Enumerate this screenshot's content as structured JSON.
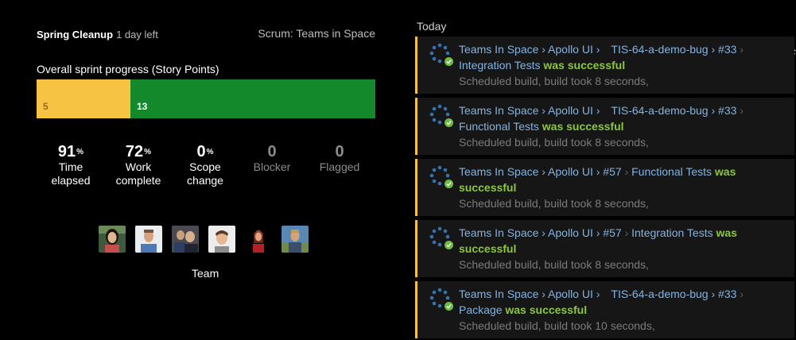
{
  "sprint": {
    "name": "Spring Cleanup",
    "days_left": "1 day left",
    "board": "Scrum: Teams in Space"
  },
  "progress": {
    "title": "Overall sprint progress (Story Points)",
    "todo_points": "5",
    "done_points": "13",
    "todo_color": "#f6c342",
    "done_color": "#14892c"
  },
  "stats": [
    {
      "value": "91",
      "unit": "%",
      "label_1": "Time",
      "label_2": "elapsed"
    },
    {
      "value": "72",
      "unit": "%",
      "label_1": "Work",
      "label_2": "complete"
    },
    {
      "value": "0",
      "unit": "%",
      "label_1": "Scope",
      "label_2": "change"
    },
    {
      "value": "0",
      "unit": "",
      "label_1": "Blocker",
      "label_2": ""
    },
    {
      "value": "0",
      "unit": "",
      "label_1": "Flagged",
      "label_2": ""
    }
  ],
  "team": {
    "label": "Team",
    "member_count": 6
  },
  "feed": {
    "heading": "Today",
    "builds": [
      {
        "line1_a": "Teams In Space › Apollo UI ›",
        "line1_b": "TIS-64-a-demo-bug › #33",
        "sep": "›",
        "job": "Integration Tests",
        "status": "was successful",
        "meta": "Scheduled build, build took 8 seconds,"
      },
      {
        "line1_a": "Teams In Space › Apollo UI ›",
        "line1_b": "TIS-64-a-demo-bug › #33",
        "sep": "›",
        "job": "Functional Tests",
        "status": "was successful",
        "meta": "Scheduled build, build took 8 seconds,"
      },
      {
        "line1_a": "Teams In Space › Apollo UI › #57",
        "sep": "›",
        "job": "Functional Tests",
        "status_a": "was",
        "status_b": "successful",
        "meta": "Scheduled build, build took 8 seconds,"
      },
      {
        "line1_a": "Teams In Space › Apollo UI › #57",
        "sep": "›",
        "job": "Integration Tests",
        "status_a": "was",
        "status_b": "successful",
        "meta": "Scheduled build, build took 8 seconds,"
      },
      {
        "line1_a": "Teams In Space › Apollo UI ›",
        "line1_b": "TIS-64-a-demo-bug › #33",
        "sep": "›",
        "job": "Package",
        "status": "was successful",
        "meta": "Scheduled build, build took 10 seconds,"
      }
    ]
  },
  "colors": {
    "background": "#000000",
    "card": "#161616",
    "link": "#84b3e0",
    "success": "#8cc63f",
    "card_accent": "#f6c342"
  }
}
